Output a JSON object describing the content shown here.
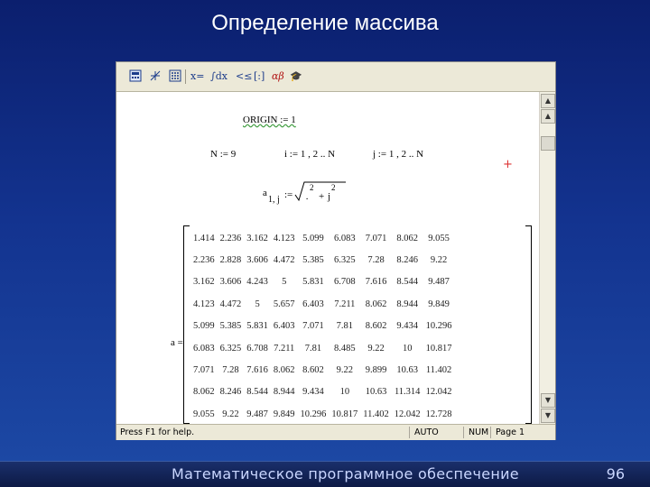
{
  "slide": {
    "title": "Определение массива",
    "footer_text": "Математическое программное обеспечение",
    "page_number": "96"
  },
  "toolbar": {
    "items": [
      "x=",
      "∫dx",
      "<≤",
      "[:]",
      "αβ",
      "🎓"
    ]
  },
  "worksheet": {
    "origin": "ORIGIN := 1",
    "n_def": "N := 9",
    "i_def": "i := 1 , 2 .. N",
    "j_def": "j := 1 , 2 .. N",
    "a_lhs": "a",
    "a_sub": "1, j",
    "a_assign": ":=",
    "i2": "2",
    "j2": "2",
    "plus": "+",
    "matrix_label": "a =",
    "matrix": [
      [
        "1.414",
        "2.236",
        "3.162",
        "4.123",
        "5.099",
        "6.083",
        "7.071",
        "8.062",
        "9.055"
      ],
      [
        "2.236",
        "2.828",
        "3.606",
        "4.472",
        "5.385",
        "6.325",
        "7.28",
        "8.246",
        "9.22"
      ],
      [
        "3.162",
        "3.606",
        "4.243",
        "5",
        "5.831",
        "6.708",
        "7.616",
        "8.544",
        "9.487"
      ],
      [
        "4.123",
        "4.472",
        "5",
        "5.657",
        "6.403",
        "7.211",
        "8.062",
        "8.944",
        "9.849"
      ],
      [
        "5.099",
        "5.385",
        "5.831",
        "6.403",
        "7.071",
        "7.81",
        "8.602",
        "9.434",
        "10.296"
      ],
      [
        "6.083",
        "6.325",
        "6.708",
        "7.211",
        "7.81",
        "8.485",
        "9.22",
        "10",
        "10.817"
      ],
      [
        "7.071",
        "7.28",
        "7.616",
        "8.062",
        "8.602",
        "9.22",
        "9.899",
        "10.63",
        "11.402"
      ],
      [
        "8.062",
        "8.246",
        "8.544",
        "8.944",
        "9.434",
        "10",
        "10.63",
        "11.314",
        "12.042"
      ],
      [
        "9.055",
        "9.22",
        "9.487",
        "9.849",
        "10.296",
        "10.817",
        "11.402",
        "12.042",
        "12.728"
      ]
    ]
  },
  "status": {
    "help": "Press F1 for help.",
    "mode": "AUTO",
    "num": "NUM",
    "page": "Page 1"
  },
  "colors": {
    "background": "#13338f",
    "accent_plus": "#dd3333"
  },
  "icons": [
    "calculator-icon",
    "graph-icon",
    "matrix-icon",
    "evaluate-icon",
    "calculus-icon",
    "boolean-icon",
    "programming-icon",
    "greek-icon",
    "symbolic-icon"
  ]
}
